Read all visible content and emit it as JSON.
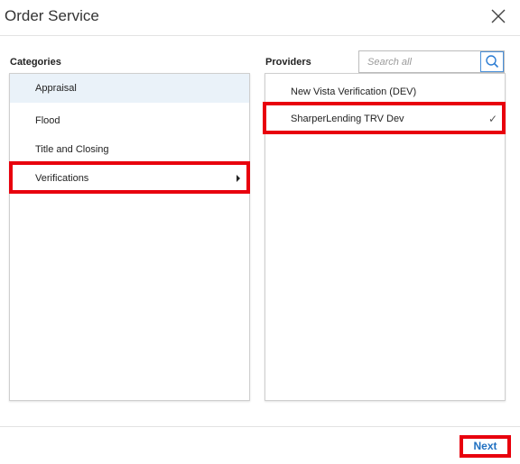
{
  "dialog": {
    "title": "Order Service",
    "close_icon": "close-icon"
  },
  "categories": {
    "label": "Categories",
    "items": [
      {
        "label": "Appraisal"
      },
      {
        "label": "Flood"
      },
      {
        "label": "Title and Closing"
      },
      {
        "label": "Verifications"
      }
    ]
  },
  "providers": {
    "label": "Providers",
    "search_placeholder": "Search all",
    "search_icon": "search-icon",
    "items": [
      {
        "label": "New Vista Verification (DEV)"
      },
      {
        "label": "SharperLending TRV Dev",
        "check": "✓"
      }
    ]
  },
  "footer": {
    "next_label": "Next"
  },
  "colors": {
    "accent": "#1e6fc0",
    "highlight": "#e8000d",
    "selected_row": "#eaf2f9"
  }
}
